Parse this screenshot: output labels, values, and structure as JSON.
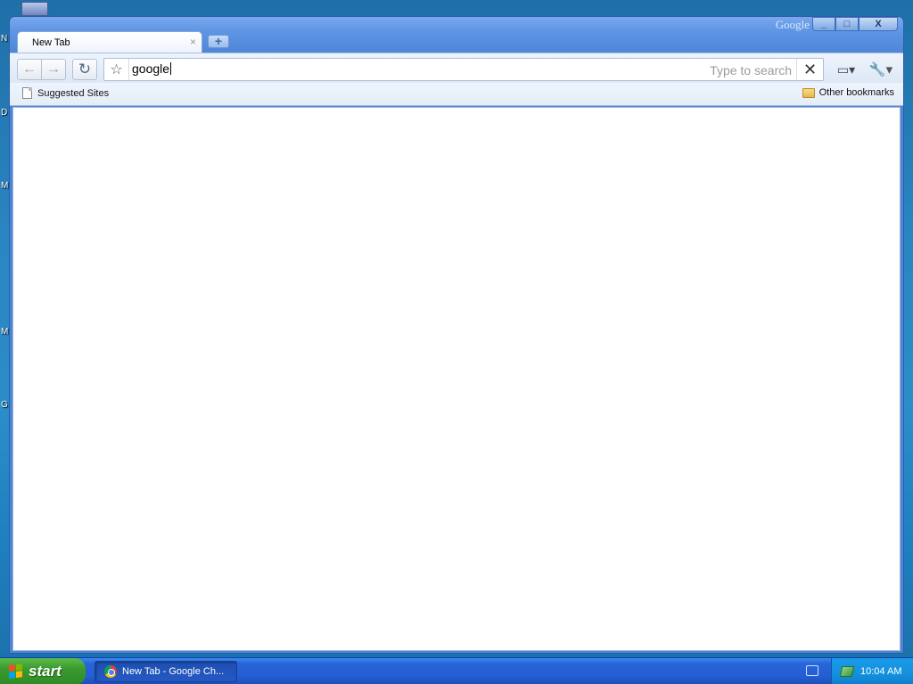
{
  "desktop": {
    "left_labels": [
      "N",
      "D",
      "M",
      "M",
      "G"
    ]
  },
  "window": {
    "brand": "Google",
    "buttons": {
      "minimize": "_",
      "maximize": "□",
      "close": "X"
    },
    "tab": {
      "title": "New Tab",
      "close": "×"
    },
    "new_tab": "+"
  },
  "toolbar": {
    "back": "←",
    "forward": "→",
    "reload": "↻",
    "star": "☆",
    "omnibox_value": "google",
    "omnibox_hint": "Type to search",
    "omnibox_clear": "✕",
    "page_menu": "▭▾",
    "wrench_menu": "🔧▾"
  },
  "bookmarks": {
    "suggested": "Suggested Sites",
    "other": "Other bookmarks"
  },
  "taskbar": {
    "start": "start",
    "task_label": "New Tab - Google Ch...",
    "clock": "10:04 AM"
  },
  "colors": {
    "taskbar_blue": "#245ed3",
    "start_green": "#3a9a2f",
    "window_frame": "#4b85d8"
  }
}
